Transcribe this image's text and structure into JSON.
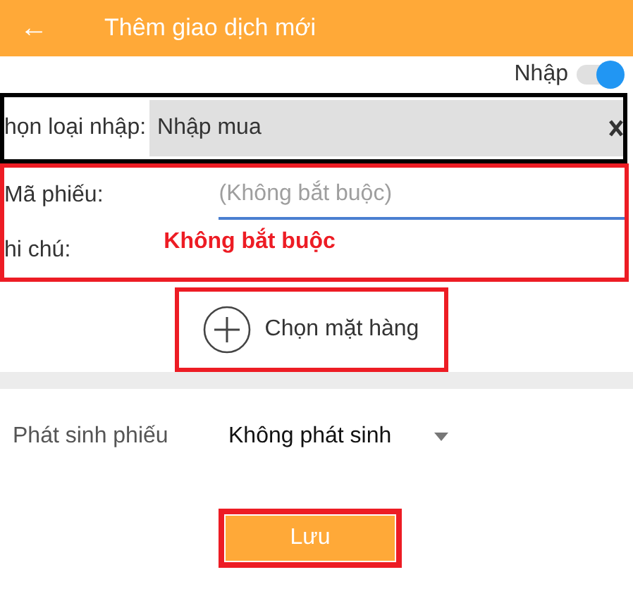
{
  "header": {
    "back": "←",
    "title": "Thêm giao dịch mới"
  },
  "mode_toggle": {
    "label": "Nhập",
    "on": true
  },
  "import_type": {
    "label": "họn loại nhập:",
    "value": "Nhập mua"
  },
  "optional_fields": [
    {
      "label": "Mã phiếu:",
      "placeholder": "(Không bắt buộc)"
    },
    {
      "label": "hi chú:"
    }
  ],
  "annotation_note": "Không bắt buộc",
  "add_item": {
    "label": "Chọn mặt hàng"
  },
  "voucher": {
    "label": "Phát sinh phiếu",
    "value": "Không phát sinh"
  },
  "save_button": "Lưu"
}
